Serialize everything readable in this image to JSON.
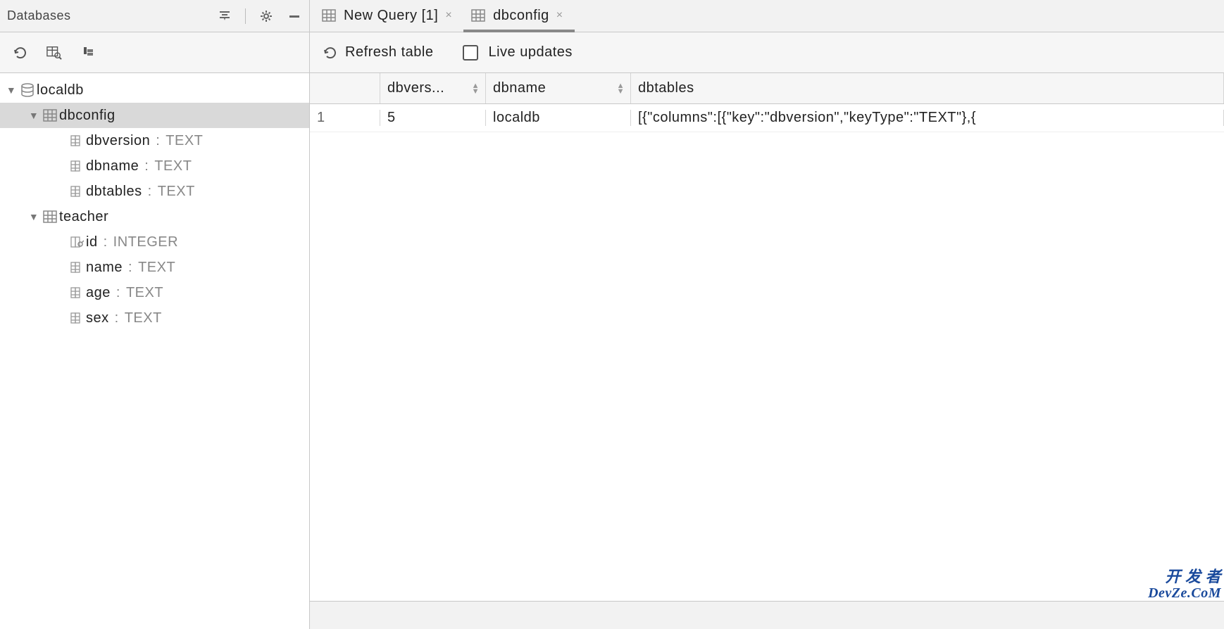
{
  "panel": {
    "title": "Databases"
  },
  "tree": {
    "db": {
      "name": "localdb"
    },
    "tables": [
      {
        "name": "dbconfig",
        "selected": true,
        "columns": [
          {
            "name": "dbversion",
            "type": "TEXT",
            "pk": false
          },
          {
            "name": "dbname",
            "type": "TEXT",
            "pk": false
          },
          {
            "name": "dbtables",
            "type": "TEXT",
            "pk": false
          }
        ]
      },
      {
        "name": "teacher",
        "selected": false,
        "columns": [
          {
            "name": "id",
            "type": "INTEGER",
            "pk": true
          },
          {
            "name": "name",
            "type": "TEXT",
            "pk": false
          },
          {
            "name": "age",
            "type": "TEXT",
            "pk": false
          },
          {
            "name": "sex",
            "type": "TEXT",
            "pk": false
          }
        ]
      }
    ]
  },
  "tabs": [
    {
      "label": "New Query [1]",
      "active": false
    },
    {
      "label": "dbconfig",
      "active": true
    }
  ],
  "toolbar": {
    "refresh": "Refresh table",
    "live": "Live updates",
    "live_checked": false
  },
  "grid": {
    "headers": [
      {
        "label": "dbvers...",
        "sortable": true
      },
      {
        "label": "dbname",
        "sortable": true
      },
      {
        "label": "dbtables",
        "sortable": false
      }
    ],
    "rows": [
      {
        "num": "1",
        "cells": [
          "5",
          "localdb",
          "[{\"columns\":[{\"key\":\"dbversion\",\"keyType\":\"TEXT\"},{"
        ]
      }
    ]
  },
  "watermark": {
    "line1": "开 发 者",
    "line2": "DevZe.CoM"
  }
}
